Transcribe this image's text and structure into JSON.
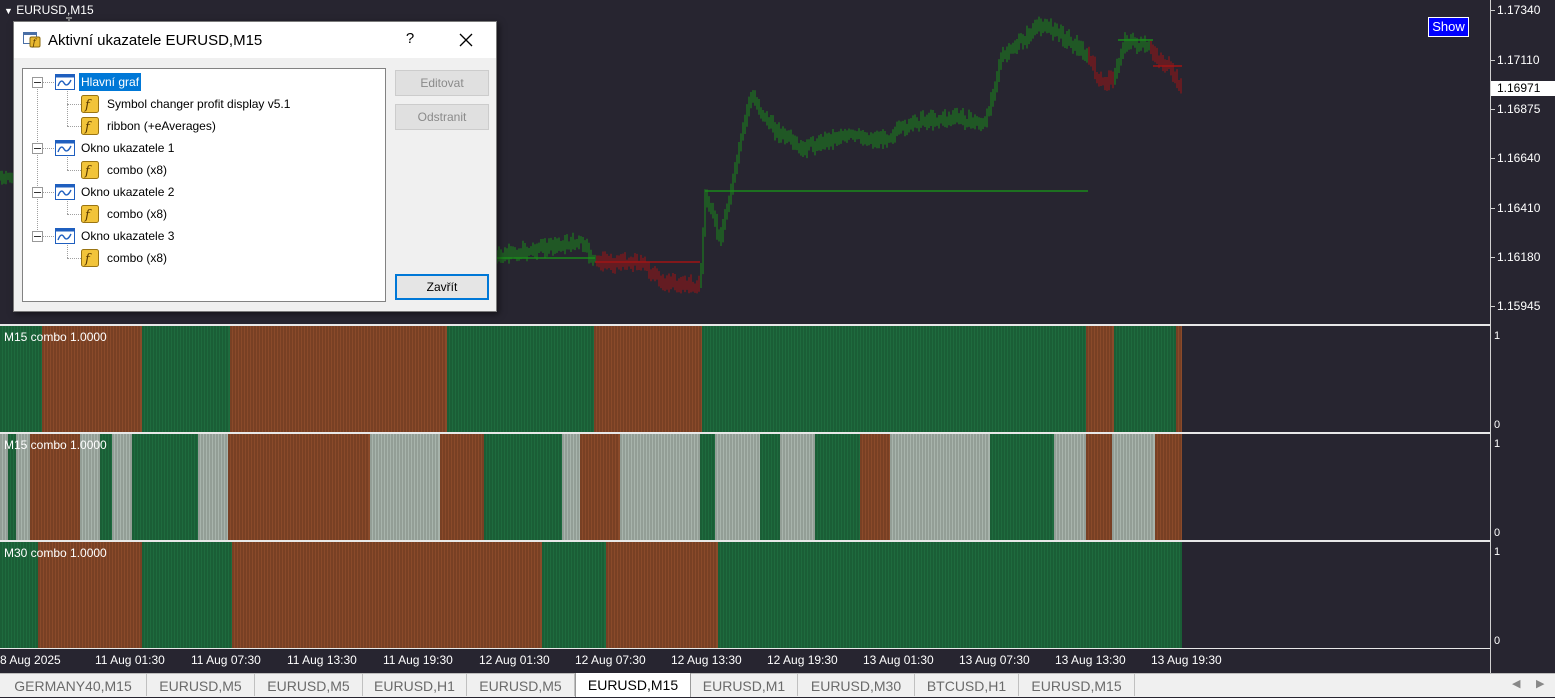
{
  "chart": {
    "symbol_title": "EURUSD,M15",
    "show_button": "Show",
    "price_labels": [
      "1.17340",
      "1.17110",
      "1.16875",
      "1.16640",
      "1.16410",
      "1.16180",
      "1.15945"
    ],
    "current_price": "1.16971",
    "colors": {
      "bull": "#1a8a1a",
      "bear": "#a01414",
      "pane_green": "#1e6b3e",
      "pane_brown": "#8a4a2a",
      "pane_gray": "#a8b4ac"
    }
  },
  "panes": [
    {
      "label": "M15 combo   1.0000",
      "top_value": "1",
      "bottom_value": "0"
    },
    {
      "label": "M15 combo   1.0000",
      "top_value": "1",
      "bottom_value": "0"
    },
    {
      "label": "M30 combo   1.0000",
      "top_value": "1",
      "bottom_value": "0"
    }
  ],
  "time_axis": [
    "8 Aug 2025",
    "11 Aug 01:30",
    "11 Aug 07:30",
    "11 Aug 13:30",
    "11 Aug 19:30",
    "12 Aug 01:30",
    "12 Aug 07:30",
    "12 Aug 13:30",
    "12 Aug 19:30",
    "13 Aug 01:30",
    "13 Aug 07:30",
    "13 Aug 13:30",
    "13 Aug 19:30"
  ],
  "tabs": [
    {
      "label": "GERMANY40,M15"
    },
    {
      "label": "EURUSD,M5"
    },
    {
      "label": "EURUSD,M5"
    },
    {
      "label": "EURUSD,H1"
    },
    {
      "label": "EURUSD,M5"
    },
    {
      "label": "EURUSD,M15",
      "active": true
    },
    {
      "label": "EURUSD,M1"
    },
    {
      "label": "EURUSD,M30"
    },
    {
      "label": "BTCUSD,H1"
    },
    {
      "label": "EURUSD,M15"
    }
  ],
  "dialog": {
    "title": "Aktivní ukazatele EURUSD,M15",
    "help": "?",
    "tree": {
      "main": "Hlavní graf",
      "main_items": [
        "Symbol changer profit display v5.1",
        "ribbon (+eAverages)"
      ],
      "windows": [
        {
          "label": "Okno ukazatele 1",
          "item": "combo (x8)"
        },
        {
          "label": "Okno ukazatele 2",
          "item": "combo (x8)"
        },
        {
          "label": "Okno ukazatele 3",
          "item": "combo (x8)"
        }
      ]
    },
    "edit_button": "Editovat",
    "delete_button": "Odstranit",
    "close_button": "Zavřít"
  }
}
